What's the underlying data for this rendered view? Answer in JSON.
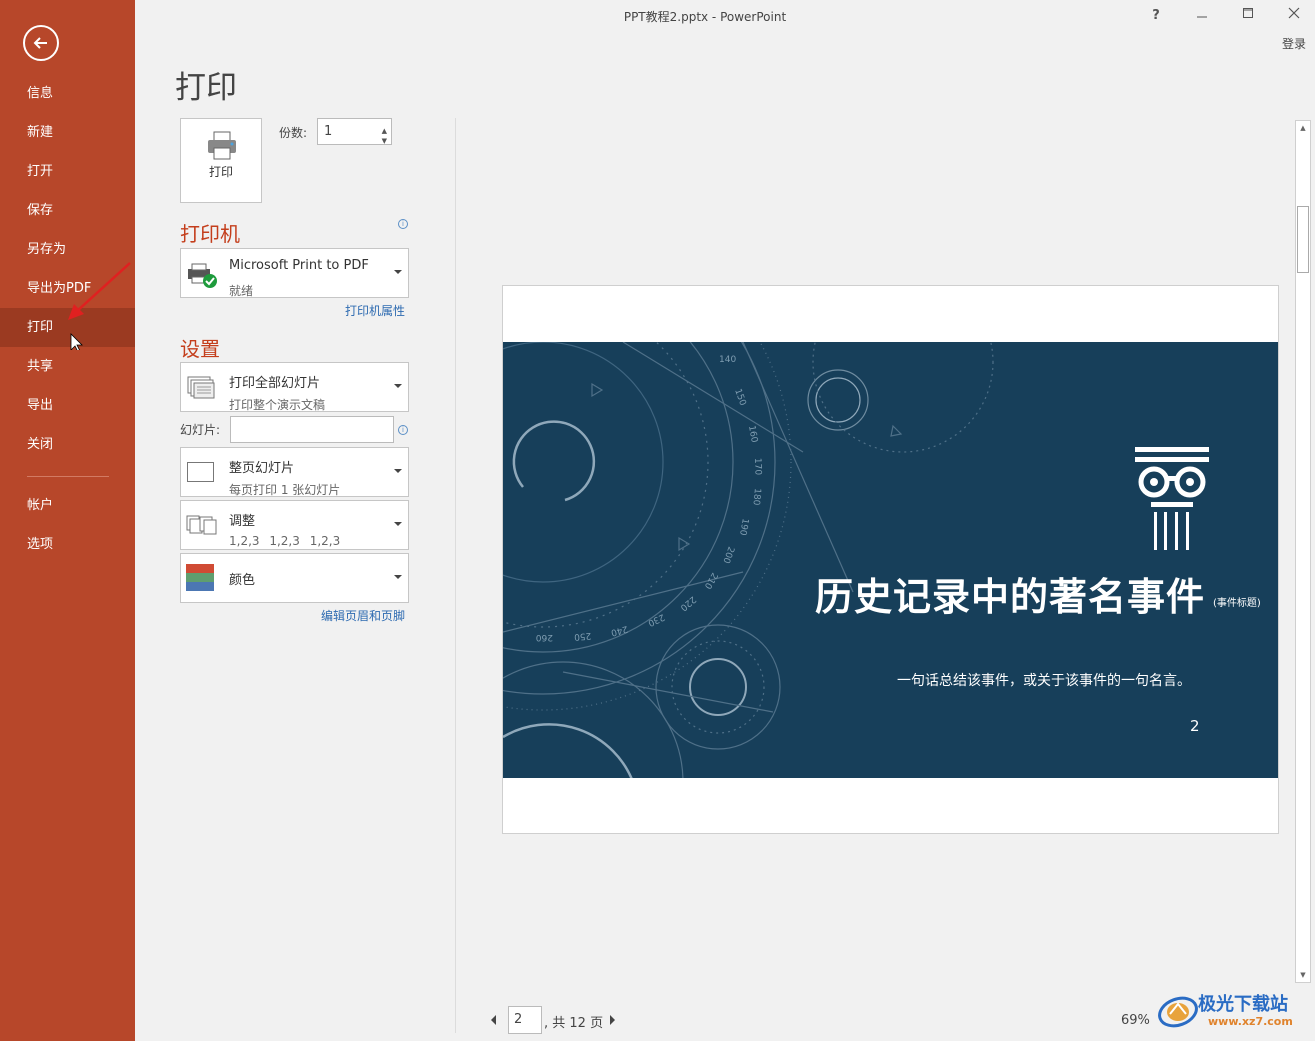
{
  "window": {
    "title": "PPT教程2.pptx - PowerPoint",
    "help": "?",
    "login": "登录"
  },
  "sidebar": {
    "items": [
      {
        "label": "信息"
      },
      {
        "label": "新建"
      },
      {
        "label": "打开"
      },
      {
        "label": "保存"
      },
      {
        "label": "另存为"
      },
      {
        "label": "导出为PDF"
      },
      {
        "label": "打印",
        "active": true
      },
      {
        "label": "共享"
      },
      {
        "label": "导出"
      },
      {
        "label": "关闭"
      }
    ],
    "bottom_items": [
      {
        "label": "帐户"
      },
      {
        "label": "选项"
      }
    ]
  },
  "main": {
    "heading": "打印",
    "print_button_label": "打印",
    "copies_label": "份数:",
    "copies_value": "1",
    "printer_section": "打印机",
    "printer": {
      "name": "Microsoft Print to PDF",
      "status": "就绪"
    },
    "printer_props_link": "打印机属性",
    "settings_section": "设置",
    "slides_range": {
      "line1": "打印全部幻灯片",
      "line2": "打印整个演示文稿"
    },
    "slides_label": "幻灯片:",
    "slides_value": "",
    "layout": {
      "line1": "整页幻灯片",
      "line2": "每页打印 1 张幻灯片"
    },
    "collate": {
      "line1": "调整",
      "line2": "1,2,3    1,2,3    1,2,3"
    },
    "color": {
      "line1": "颜色"
    },
    "header_footer_link": "编辑页眉和页脚"
  },
  "preview": {
    "slide_title": "历史记录中的著名事件",
    "slide_title_tag": "(事件标题)",
    "slide_subtitle": "一句话总结该事件，或关于该事件的一句名言。",
    "slide_number": "2",
    "slide_bg": "#173f5a",
    "dial_labels": [
      "140",
      "150",
      "160",
      "170",
      "180",
      "190",
      "200",
      "210",
      "220",
      "230",
      "240",
      "250",
      "260"
    ],
    "current_page": "2",
    "total_pages": ", 共 12 页",
    "zoom": "69%"
  },
  "watermark": {
    "brand": "极光下载站",
    "url": "www.xz7.com"
  },
  "colors": {
    "sidebar": "#b7472a",
    "accent": "#c43e1c",
    "link": "#2e6bb1"
  }
}
